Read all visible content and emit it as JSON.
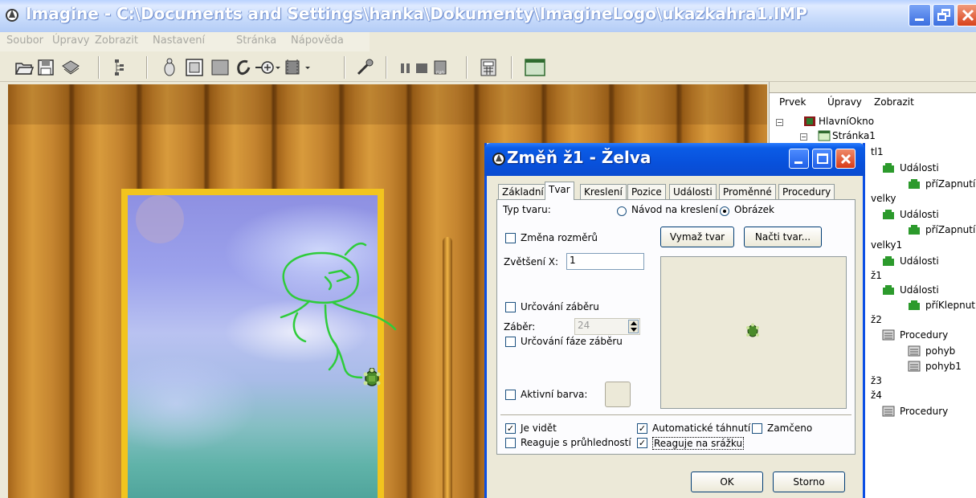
{
  "window": {
    "title": "Imagine - C:\\Documents and Settings\\hanka\\Dokumenty\\ImagineLogo\\ukazkahra1.IMP",
    "buttons": [
      "minimize",
      "restore",
      "close"
    ]
  },
  "menu": [
    "Soubor",
    "Úpravy",
    "Zobrazit",
    "Nastavení",
    "Stránka",
    "Nápověda"
  ],
  "toolbar": {
    "icons": [
      "open-folder-icon",
      "save-icon",
      "print-icon",
      "tree-icon",
      "turtle-new-icon",
      "button-icon",
      "panel-icon",
      "text-icon",
      "slider-icon",
      "media-icon",
      "magic-icon",
      "pause-icon",
      "stop-icon",
      "run-icon",
      "calculator-icon",
      "screen-icon"
    ]
  },
  "project_panel": {
    "menu": [
      "Prvek",
      "Úpravy",
      "Zobrazit"
    ],
    "tree": [
      {
        "label": "HlavníOkno",
        "icon": "main-window-icon"
      },
      {
        "label": "Stránka1",
        "icon": "page-icon"
      },
      {
        "label": "tl1",
        "icon": ""
      },
      {
        "label": "Události",
        "icon": "events-icon"
      },
      {
        "label": "příZapnutí",
        "icon": "event-icon"
      },
      {
        "label": "velky",
        "icon": ""
      },
      {
        "label": "Události",
        "icon": "events-icon"
      },
      {
        "label": "příZapnutí",
        "icon": "event-icon"
      },
      {
        "label": "velky1",
        "icon": ""
      },
      {
        "label": "Události",
        "icon": "events-icon"
      },
      {
        "label": "ž1",
        "icon": ""
      },
      {
        "label": "Události",
        "icon": "events-icon"
      },
      {
        "label": "příKlepnutí",
        "icon": "event-icon"
      },
      {
        "label": "ž2",
        "icon": ""
      },
      {
        "label": "Procedury",
        "icon": "procedures-icon"
      },
      {
        "label": "pohyb",
        "icon": "procedure-icon"
      },
      {
        "label": "pohyb1",
        "icon": "procedure-icon"
      },
      {
        "label": "ž3",
        "icon": ""
      },
      {
        "label": "ž4",
        "icon": ""
      },
      {
        "label": "Procedury",
        "icon": "procedures-icon"
      }
    ]
  },
  "dialog": {
    "title": "Změň ž1  - Želva",
    "tabs": [
      "Základní",
      "Tvar",
      "Kreslení",
      "Pozice",
      "Události",
      "Proměnné",
      "Procedury"
    ],
    "active_tab": "Tvar",
    "shape_type_label": "Typ tvaru:",
    "radio_draw": "Návod na kreslení",
    "radio_image": "Obrázek",
    "radio_selected": "Obrázek",
    "resize_label": "Změna rozměrů",
    "resize_checked": false,
    "clear_shape_button": "Vymaž tvar",
    "load_shape_button": "Načti tvar...",
    "zoom_x_label": "Zvětšení X:",
    "zoom_x_value": "1",
    "frame_define_label": "Určování záběru",
    "frame_define_checked": false,
    "frame_label": "Záběr:",
    "frame_value": "24",
    "frame_phase_label": "Určování fáze záběru",
    "frame_phase_checked": false,
    "active_color_label": "Aktivní barva:",
    "active_color_checked": false,
    "visible_label": "Je vidět",
    "visible_checked": true,
    "auto_drag_label": "Automatické táhnutí",
    "auto_drag_checked": true,
    "locked_label": "Zamčeno",
    "locked_checked": false,
    "transparency_label": "Reaguje s průhledností",
    "transparency_checked": false,
    "collision_label": "Reaguje na srážku",
    "collision_checked": true,
    "ok_button": "OK",
    "cancel_button": "Storno"
  },
  "colors": {
    "title_bar": "#0851dc",
    "frame_yellow": "#f2c41e",
    "drawing_green": "#2ecc3a",
    "dialog_bg": "#ece9d8"
  }
}
